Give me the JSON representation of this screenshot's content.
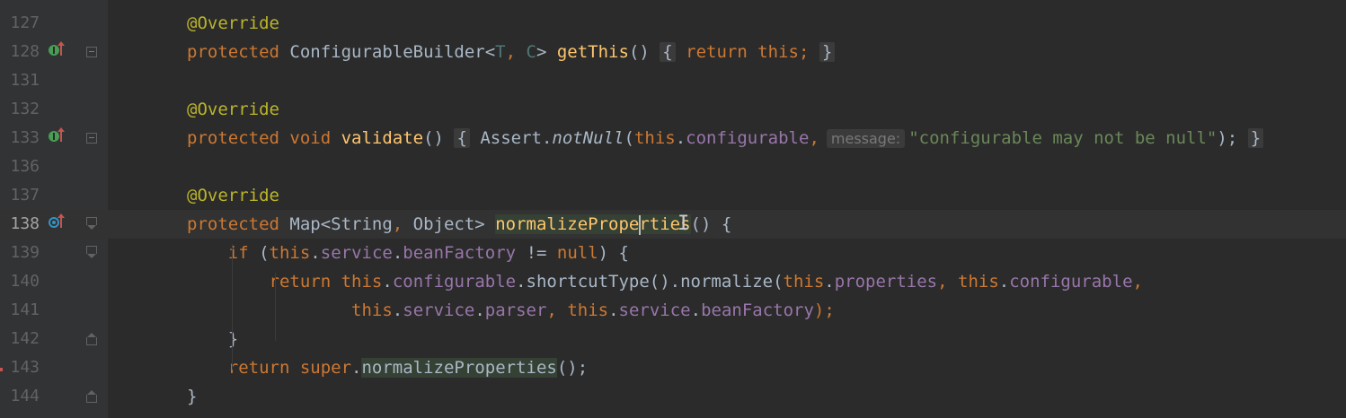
{
  "editor": {
    "rows": [
      {
        "num": "127",
        "tokens": [
          {
            "t": "@Override",
            "c": "an"
          }
        ]
      },
      {
        "num": "128",
        "tokens": [
          {
            "t": "protected ",
            "c": "kw"
          },
          {
            "t": "ConfigurableBuilder<",
            "c": "ty"
          },
          {
            "t": "T",
            "c": "tp"
          },
          {
            "t": ", ",
            "c": "kw"
          },
          {
            "t": "C",
            "c": "tp"
          },
          {
            "t": "> ",
            "c": "ty"
          },
          {
            "t": "getThis",
            "c": "fn"
          },
          {
            "t": "() ",
            "c": "ty"
          },
          {
            "t": "{",
            "c": "fold"
          },
          {
            "t": " ",
            "c": "ty"
          },
          {
            "t": "return this;",
            "c": "kw"
          },
          {
            "t": " ",
            "c": "ty"
          },
          {
            "t": "}",
            "c": "fold"
          }
        ]
      },
      {
        "num": "131",
        "tokens": []
      },
      {
        "num": "132",
        "tokens": [
          {
            "t": "@Override",
            "c": "an"
          }
        ]
      },
      {
        "num": "133",
        "tokens": [
          {
            "t": "protected void ",
            "c": "kw"
          },
          {
            "t": "validate",
            "c": "fn"
          },
          {
            "t": "() ",
            "c": "ty"
          },
          {
            "t": "{",
            "c": "fold"
          },
          {
            "t": " Assert.",
            "c": "ty"
          },
          {
            "t": "notNull",
            "c": "it"
          },
          {
            "t": "(",
            "c": "ty"
          },
          {
            "t": "this",
            "c": "kw"
          },
          {
            "t": ".",
            "c": "ty"
          },
          {
            "t": "configurable",
            "c": "fld"
          },
          {
            "t": ",",
            "c": "kw"
          },
          {
            "t": "message:",
            "c": "hint"
          },
          {
            "t": "\"configurable may not be null\"",
            "c": "str"
          },
          {
            "t": ");",
            "c": "ty"
          },
          {
            "t": " ",
            "c": "ty"
          },
          {
            "t": "}",
            "c": "fold"
          }
        ]
      },
      {
        "num": "136",
        "tokens": []
      },
      {
        "num": "137",
        "tokens": [
          {
            "t": "@Override",
            "c": "an"
          }
        ]
      },
      {
        "num": "138",
        "tokens": [
          {
            "t": "protected ",
            "c": "kw"
          },
          {
            "t": "Map<String",
            "c": "ty"
          },
          {
            "t": ", ",
            "c": "kw"
          },
          {
            "t": "Object> ",
            "c": "ty"
          },
          {
            "t": "normalizeProperties",
            "c": "fn hl"
          },
          {
            "t": "() {",
            "c": "ty"
          }
        ]
      },
      {
        "num": "139",
        "tokens": [
          {
            "t": "    if ",
            "c": "kw"
          },
          {
            "t": "(",
            "c": "ty"
          },
          {
            "t": "this",
            "c": "kw"
          },
          {
            "t": ".",
            "c": "ty"
          },
          {
            "t": "service",
            "c": "fld"
          },
          {
            "t": ".",
            "c": "ty"
          },
          {
            "t": "beanFactory",
            "c": "fld"
          },
          {
            "t": " != ",
            "c": "ty"
          },
          {
            "t": "null",
            "c": "kw"
          },
          {
            "t": ") {",
            "c": "ty"
          }
        ]
      },
      {
        "num": "140",
        "tokens": [
          {
            "t": "        return ",
            "c": "kw"
          },
          {
            "t": "this",
            "c": "kw"
          },
          {
            "t": ".",
            "c": "ty"
          },
          {
            "t": "configurable",
            "c": "fld"
          },
          {
            "t": ".shortcutType().normalize(",
            "c": "ty"
          },
          {
            "t": "this",
            "c": "kw"
          },
          {
            "t": ".",
            "c": "ty"
          },
          {
            "t": "properties",
            "c": "fld"
          },
          {
            "t": ", ",
            "c": "kw"
          },
          {
            "t": "this",
            "c": "kw"
          },
          {
            "t": ".",
            "c": "ty"
          },
          {
            "t": "configurable",
            "c": "fld"
          },
          {
            "t": ",",
            "c": "kw"
          }
        ]
      },
      {
        "num": "141",
        "tokens": [
          {
            "t": "                ",
            "c": "ty"
          },
          {
            "t": "this",
            "c": "kw"
          },
          {
            "t": ".",
            "c": "ty"
          },
          {
            "t": "service",
            "c": "fld"
          },
          {
            "t": ".",
            "c": "ty"
          },
          {
            "t": "parser",
            "c": "fld"
          },
          {
            "t": ", ",
            "c": "kw"
          },
          {
            "t": "this",
            "c": "kw"
          },
          {
            "t": ".",
            "c": "ty"
          },
          {
            "t": "service",
            "c": "fld"
          },
          {
            "t": ".",
            "c": "ty"
          },
          {
            "t": "beanFactory",
            "c": "fld"
          },
          {
            "t": ");",
            "c": "kw"
          }
        ]
      },
      {
        "num": "142",
        "tokens": [
          {
            "t": "    }",
            "c": "ty"
          }
        ]
      },
      {
        "num": "143",
        "tokens": [
          {
            "t": "    return super",
            "c": "kw"
          },
          {
            "t": ".",
            "c": "ty"
          },
          {
            "t": "normalizeProperties",
            "c": "ty hl"
          },
          {
            "t": "();",
            "c": "ty"
          }
        ]
      },
      {
        "num": "144",
        "tokens": [
          {
            "t": "}",
            "c": "ty"
          }
        ]
      }
    ]
  }
}
